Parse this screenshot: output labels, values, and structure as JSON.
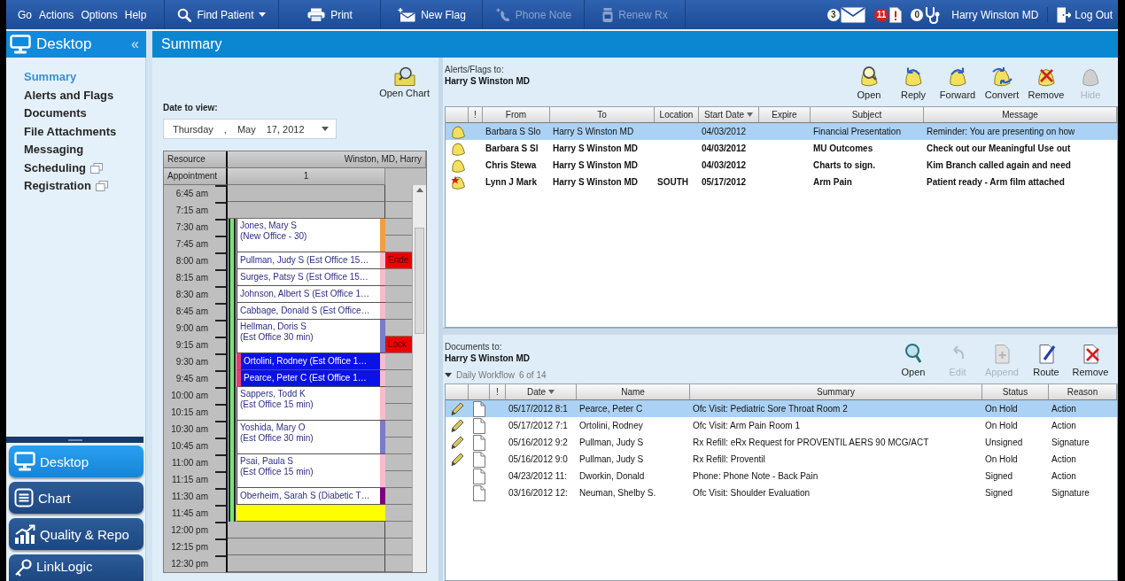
{
  "toolbar": {
    "menus": [
      "Go",
      "Actions",
      "Options",
      "Help"
    ],
    "buttons": [
      {
        "label": "Find Patient",
        "kind": "find",
        "dropdown": true,
        "disabled": false
      },
      {
        "label": "Print",
        "kind": "print",
        "dropdown": false,
        "disabled": false
      },
      {
        "label": "New Flag",
        "kind": "flag",
        "dropdown": false,
        "disabled": false
      },
      {
        "label": "Phone Note",
        "kind": "phone",
        "dropdown": false,
        "disabled": true
      },
      {
        "label": "Renew Rx",
        "kind": "rx",
        "dropdown": false,
        "disabled": true
      }
    ],
    "indicators": [
      {
        "kind": "mail",
        "count": "3"
      },
      {
        "kind": "flags",
        "count": "11"
      },
      {
        "kind": "tasks",
        "count": "0"
      }
    ],
    "user": "Harry Winston MD",
    "logout": "Log Out"
  },
  "sidebar": {
    "title": "Desktop",
    "collapse": "«",
    "items": [
      {
        "label": "Summary",
        "selected": true,
        "popout": false
      },
      {
        "label": "Alerts and Flags",
        "selected": false,
        "popout": false
      },
      {
        "label": "Documents",
        "selected": false,
        "popout": false
      },
      {
        "label": "File Attachments",
        "selected": false,
        "popout": false
      },
      {
        "label": "Messaging",
        "selected": false,
        "popout": false
      },
      {
        "label": "Scheduling",
        "selected": false,
        "popout": true
      },
      {
        "label": "Registration",
        "selected": false,
        "popout": true
      }
    ],
    "modules": [
      {
        "label": "Desktop",
        "kind": "desktop",
        "selected": true
      },
      {
        "label": "Chart",
        "kind": "chart",
        "selected": false
      },
      {
        "label": "Quality & Repo",
        "kind": "quality",
        "selected": false
      },
      {
        "label": "LinkLogic",
        "kind": "link",
        "selected": false
      }
    ]
  },
  "page_title": "Summary",
  "schedule": {
    "open_chart": "Open Chart",
    "date_label": "Date to view:",
    "date_parts": [
      "Thursday",
      ",",
      "May",
      "17, 2012"
    ],
    "resource_label": "Resource",
    "resource": "Winston, MD, Harry",
    "appointment_label": "Appointment",
    "column": "1",
    "rows": [
      {
        "time": "6:45 am",
        "open": false
      },
      {
        "time": "7:15 am",
        "open": false
      },
      {
        "time": "7:30 am",
        "open": true,
        "appointment": {
          "kind": "double",
          "lines": [
            "Jones, Mary S",
            "(New Office - 30)"
          ],
          "color": "#f0a040",
          "selected": false
        }
      },
      {
        "time": "7:45 am",
        "open": true
      },
      {
        "time": "8:00 am",
        "open": true,
        "appointment": {
          "kind": "single",
          "lines": [
            "Pullman, Judy S (Est Office 15…"
          ],
          "color": "#f6bccb",
          "selected": false
        },
        "status": {
          "label": "Ende",
          "color": "#ee0000"
        }
      },
      {
        "time": "8:15 am",
        "open": true,
        "appointment": {
          "kind": "single",
          "lines": [
            "Surges, Patsy S (Est Office 15…"
          ],
          "color": "#f6bccb",
          "selected": false
        }
      },
      {
        "time": "8:30 am",
        "open": true,
        "appointment": {
          "kind": "single",
          "lines": [
            "Johnson, Albert S (Est Office 1…"
          ],
          "color": "#f6bccb",
          "selected": false
        }
      },
      {
        "time": "8:45 am",
        "open": true,
        "appointment": {
          "kind": "single",
          "lines": [
            "Cabbage, Donald S (Est Office…"
          ],
          "color": "#f6bccb",
          "selected": false
        }
      },
      {
        "time": "9:00 am",
        "open": true,
        "appointment": {
          "kind": "double",
          "lines": [
            "Hellman, Doris S",
            "(Est Office 30 min)"
          ],
          "color": "#7a7ac8",
          "selected": false
        }
      },
      {
        "time": "9:15 am",
        "open": true,
        "status": {
          "label": "Lock",
          "color": "#ee0000"
        }
      },
      {
        "time": "9:30 am",
        "open": true,
        "appointment": {
          "kind": "single",
          "lines": [
            "Ortolini, Rodney (Est Office 1…"
          ],
          "color": "#f6bccb",
          "selected": true
        }
      },
      {
        "time": "9:45 am",
        "open": true,
        "appointment": {
          "kind": "single",
          "lines": [
            "Pearce, Peter C (Est Office 1…"
          ],
          "color": "#f6bccb",
          "selected": true
        }
      },
      {
        "time": "10:00 am",
        "open": true,
        "appointment": {
          "kind": "double",
          "lines": [
            "Sappers, Todd K",
            "(Est Office 15 min)"
          ],
          "color": "#f6bccb",
          "selected": false
        }
      },
      {
        "time": "10:15 am",
        "open": true
      },
      {
        "time": "10:30 am",
        "open": true,
        "appointment": {
          "kind": "double",
          "lines": [
            "Yoshida, Mary O",
            "(Est Office 30 min)"
          ],
          "color": "#7a7ac8",
          "selected": false
        }
      },
      {
        "time": "10:45 am",
        "open": true
      },
      {
        "time": "11:00 am",
        "open": true,
        "appointment": {
          "kind": "double",
          "lines": [
            "Psai, Paula S",
            "(Est Office 15 min)"
          ],
          "color": "#f6bccb",
          "selected": false
        }
      },
      {
        "time": "11:15 am",
        "open": true
      },
      {
        "time": "11:30 am",
        "open": true,
        "appointment": {
          "kind": "single",
          "lines": [
            "Oberheim, Sarah S (Diabetic T…"
          ],
          "color": "#800080",
          "selected": false
        }
      },
      {
        "time": "11:45 am",
        "open": true,
        "appointment": {
          "kind": "block",
          "color": "#ffff00",
          "selected": false
        }
      },
      {
        "time": "12:00 pm",
        "open": false
      },
      {
        "time": "12:15 pm",
        "open": false
      },
      {
        "time": "12:30 pm",
        "open": false
      }
    ]
  },
  "alerts": {
    "label": "Alerts/Flags to:",
    "recipient": "Harry S Winston MD",
    "actions": [
      {
        "label": "Open",
        "kind": "open",
        "disabled": false
      },
      {
        "label": "Reply",
        "kind": "reply",
        "disabled": false
      },
      {
        "label": "Forward",
        "kind": "forward",
        "disabled": false
      },
      {
        "label": "Convert",
        "kind": "convert",
        "disabled": false
      },
      {
        "label": "Remove",
        "kind": "remove",
        "disabled": false
      },
      {
        "label": "Hide",
        "kind": "hide",
        "disabled": true
      }
    ],
    "columns": [
      {
        "label": "!",
        "sorted": false
      },
      {
        "label": "From",
        "sorted": false
      },
      {
        "label": "To",
        "sorted": false
      },
      {
        "label": "Location",
        "sorted": false
      },
      {
        "label": "Start Date",
        "sorted": true
      },
      {
        "label": "Expire",
        "sorted": false
      },
      {
        "label": "Subject",
        "sorted": false
      },
      {
        "label": "Message",
        "sorted": false
      }
    ],
    "rows": [
      {
        "kind": "note",
        "selected": true,
        "unread": false,
        "from": "Barbara S Slo",
        "to": "Harry S Winston MD",
        "start_date": "04/03/2012",
        "subject": "Financial Presentation",
        "message": "Reminder: You are presenting on how"
      },
      {
        "kind": "note",
        "selected": false,
        "unread": true,
        "from": "Barbara S Sl",
        "to": "Harry S Winston MD",
        "start_date": "04/03/2012",
        "subject": "MU Outcomes",
        "message": "Check out our Meaningful Use out"
      },
      {
        "kind": "note",
        "selected": false,
        "unread": true,
        "from": "Chris Stewa",
        "to": "Harry S Winston MD",
        "start_date": "04/03/2012",
        "subject": "Charts to sign.",
        "message": "Kim Branch called again and need"
      },
      {
        "kind": "urgent",
        "selected": false,
        "unread": true,
        "from": "Lynn J Mark",
        "to": "Harry S Winston MD",
        "location": "SOUTH",
        "start_date": "05/17/2012",
        "subject": "Arm Pain",
        "message": "Patient ready - Arm film attached"
      }
    ]
  },
  "documents": {
    "label": "Documents to:",
    "recipient": "Harry S Winston MD",
    "group": {
      "label": "Daily Workflow",
      "count": "6 of 14",
      "expanded": true
    },
    "actions": [
      {
        "label": "Open",
        "kind": "open",
        "disabled": false
      },
      {
        "label": "Edit",
        "kind": "edit",
        "disabled": true
      },
      {
        "label": "Append",
        "kind": "append",
        "disabled": true
      },
      {
        "label": "Route",
        "kind": "route",
        "disabled": false
      },
      {
        "label": "Remove",
        "kind": "remove",
        "disabled": false
      }
    ],
    "columns": [
      {
        "label": "!",
        "sorted": false
      },
      {
        "label": "Date",
        "sorted": true
      },
      {
        "label": "Name",
        "sorted": false
      },
      {
        "label": "Summary",
        "sorted": false
      },
      {
        "label": "Status",
        "sorted": false
      },
      {
        "label": "Reason",
        "sorted": false
      }
    ],
    "rows": [
      {
        "selected": true,
        "editable": true,
        "date": "05/17/2012 8:1",
        "name": "Pearce, Peter C",
        "summary": "Ofc Visit: Pediatric Sore Throat Room 2",
        "status": "On Hold",
        "reason": "Action"
      },
      {
        "selected": false,
        "editable": true,
        "date": "05/17/2012 7:1",
        "name": "Ortolini, Rodney",
        "summary": "Ofc Visit: Arm Pain Room 1",
        "status": "On Hold",
        "reason": "Action"
      },
      {
        "selected": false,
        "editable": true,
        "date": "05/16/2012 9:2",
        "name": "Pullman, Judy S",
        "summary": "Rx Refill: eRx Request for PROVENTIL AERS 90 MCG/ACT",
        "status": "Unsigned",
        "reason": "Signature"
      },
      {
        "selected": false,
        "editable": true,
        "date": "05/16/2012 9:0",
        "name": "Pullman, Judy S",
        "summary": "Rx Refill: Proventil",
        "status": "On Hold",
        "reason": "Action"
      },
      {
        "selected": false,
        "editable": false,
        "date": "04/23/2012 11:",
        "name": "Dworkin, Donald",
        "summary": "Phone: Phone Note - Back Pain",
        "status": "Signed",
        "reason": "Action"
      },
      {
        "selected": false,
        "editable": false,
        "date": "03/16/2012 12:",
        "name": "Neuman, Shelby S.",
        "summary": "Ofc Visit: Shoulder Evaluation",
        "status": "Signed",
        "reason": "Signature"
      }
    ]
  }
}
